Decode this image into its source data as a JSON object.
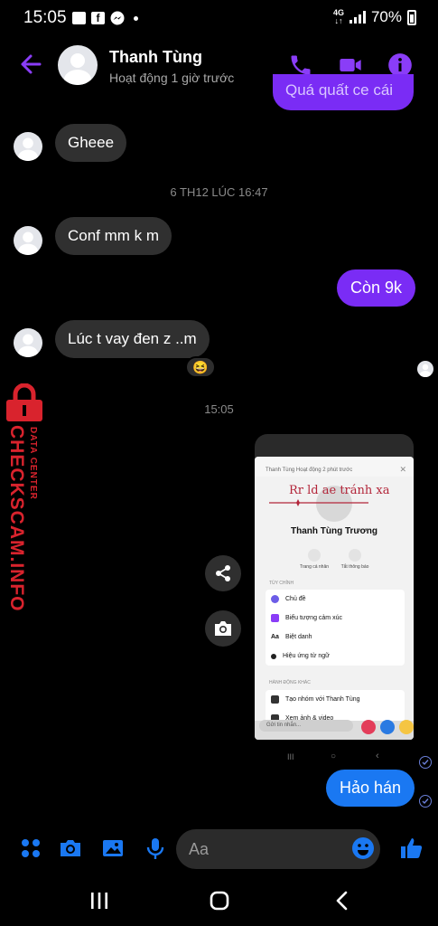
{
  "status_bar": {
    "time": "15:05",
    "network": "4G",
    "battery": "70%",
    "battery_level": 0.7
  },
  "header": {
    "contact_name": "Thanh Tùng",
    "activity": "Hoạt động 1 giờ trước",
    "icons": [
      "back-arrow-icon",
      "phone-icon",
      "video-icon",
      "info-icon"
    ]
  },
  "messages": {
    "outgoing_partial": "Quá quất ce cái",
    "m1": "Gheee",
    "timestamp1": "6 TH12 LÚC 16:47",
    "m2": "Conf mm  k m",
    "m3": "Còn 9k",
    "m4": "Lúc t vay đen z ..m",
    "m4_reaction": "😆",
    "timestamp2": "15:05",
    "m5": "Hảo hán"
  },
  "shared_screenshot": {
    "caption": "Rr ld ae tránh xa",
    "top_status": "Thanh Tùng Hoạt động 2 phút trước",
    "profile_name": "Thanh Tùng Trương",
    "action_profile": "Trang cá nhân",
    "action_mute": "Tắt thông báo",
    "section_customize": "TÙY CHỈNH",
    "row_theme": "Chủ đề",
    "row_emoji": "Biểu tượng cảm xúc",
    "row_nickname_icon": "Aa",
    "row_nickname": "Biệt danh",
    "row_word_effects": "Hiệu ứng từ ngữ",
    "section_more": "HÀNH ĐỘNG KHÁC",
    "row_group": "Tạo nhóm với Thanh Tùng",
    "row_media": "Xem ảnh & video",
    "input_placeholder": "Gửi tin nhắn..."
  },
  "watermark": {
    "main": "CHECKSCAM.INFO",
    "sub": "DATA CENTER"
  },
  "composer": {
    "placeholder": "Aa",
    "icons": [
      "menu-dots-icon",
      "camera-icon",
      "gallery-icon",
      "microphone-icon",
      "emoji-icon",
      "like-icon"
    ]
  },
  "colors": {
    "accent_purple": "#7a2cf5",
    "accent_blue": "#1a78f2",
    "incoming_bubble": "#303030",
    "watermark_red": "#d9232d"
  }
}
